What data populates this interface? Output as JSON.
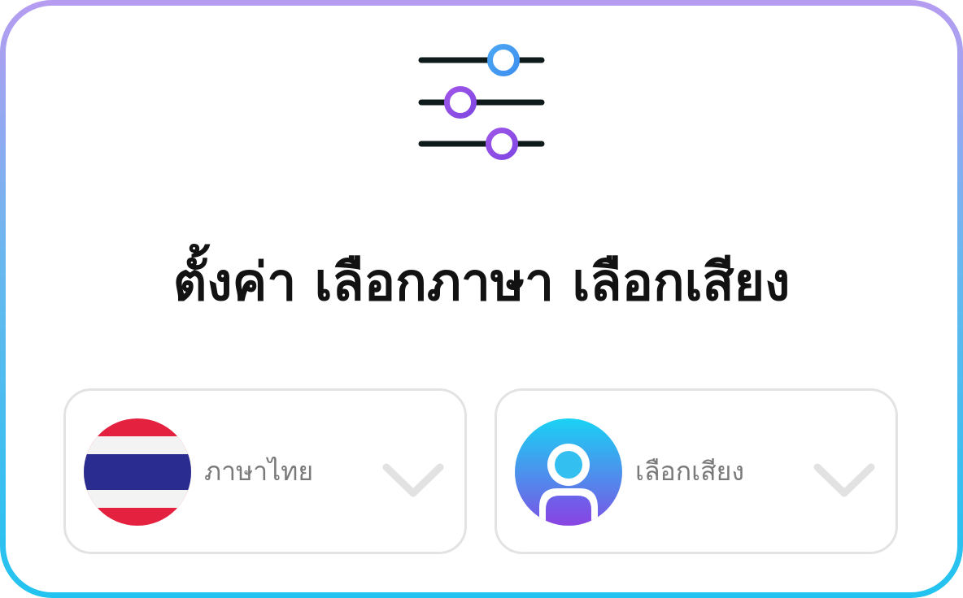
{
  "title": "ตั้งค่า เลือกภาษา เลือกเสียง",
  "icons": {
    "header": "sliders-icon",
    "language": "thailand-flag-icon",
    "voice": "user-avatar-icon",
    "dropdown": "chevron-down-icon"
  },
  "language_select": {
    "value": "ภาษาไทย"
  },
  "voice_select": {
    "value": "เลือกเสียง"
  },
  "colors": {
    "border_gradient": [
      "#b69cf0",
      "#22c3f0"
    ],
    "slider_blue": "#3f9af0",
    "slider_purple": "#8b4de6",
    "text_dark": "#121212",
    "text_muted": "#7a7a7a",
    "flag_red": "#e4223f",
    "flag_blue": "#2a2c8f"
  }
}
